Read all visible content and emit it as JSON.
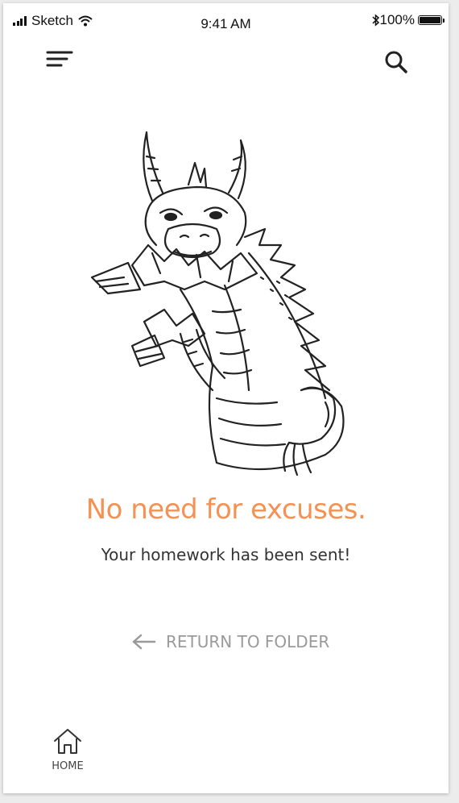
{
  "status_bar": {
    "carrier": "Sketch",
    "time": "9:41 AM",
    "battery_text": "100%",
    "battery_level": 1.0
  },
  "nav": {
    "menu_icon": "hamburger-icon",
    "search_icon": "search-icon"
  },
  "illustration": {
    "icon": "dragon-illustration"
  },
  "message": {
    "headline": "No need for excuses.",
    "subline": "Your homework has been sent!"
  },
  "actions": {
    "return_label": "RETURN TO FOLDER"
  },
  "tab_bar": {
    "home_label": "HOME"
  },
  "colors": {
    "accent": "#f39254",
    "muted": "#9a9a9a",
    "text": "#333333"
  }
}
